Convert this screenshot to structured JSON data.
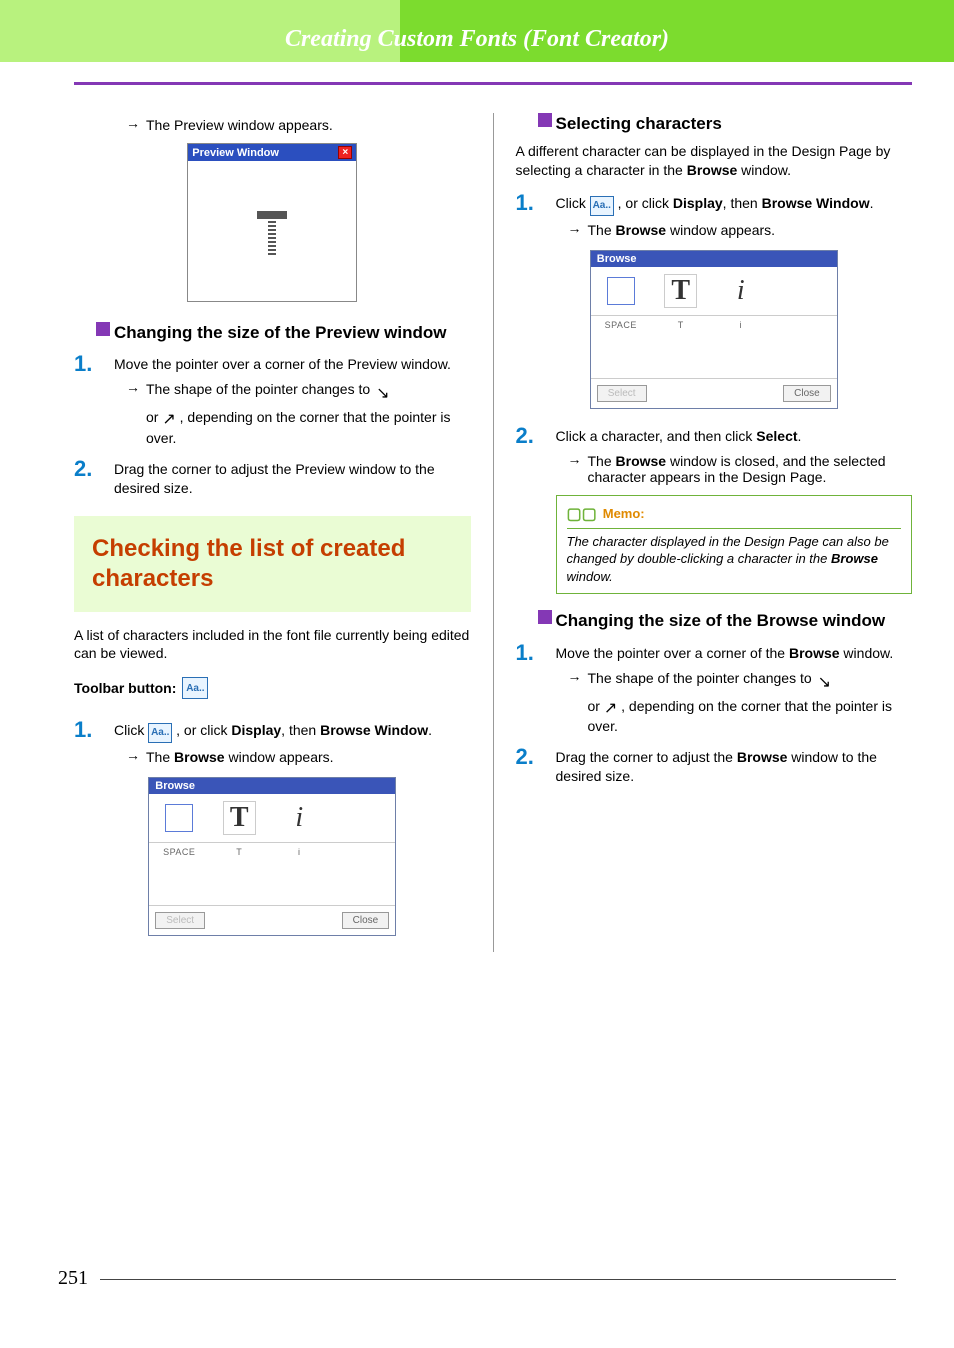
{
  "header": {
    "title": "Creating Custom Fonts (Font Creator)"
  },
  "left": {
    "preview_appears": "The Preview window appears.",
    "preview_window_title": "Preview Window",
    "sub_change_preview": "Changing the size of the Preview window",
    "step1": "Move the pointer over a corner of the Preview window.",
    "shape_changes": "The shape of the pointer changes to",
    "or_depending": "or         , depending on the corner that the pointer is over.",
    "step2": "Drag the corner to adjust the Preview window to the desired size.",
    "section_title": "Checking the list of created characters",
    "section_para": "A list of characters included in the font file currently being edited can be viewed.",
    "toolbar_label": "Toolbar button:",
    "click_prefix": "Click",
    "or_click": ", or click ",
    "display": "Display",
    "then": ", then ",
    "browse_window": "Browse Window",
    "period": ".",
    "browse_appears": "The ",
    "browse_bold": "Browse",
    "browse_appears2": " window appears."
  },
  "right": {
    "sub_selecting": "Selecting characters",
    "selecting_para_a": "A different character can be displayed in the Design Page by selecting a character in the ",
    "selecting_para_b": "Browse",
    "selecting_para_c": " window.",
    "step1_click": "Click",
    "step1_or": ", or click ",
    "step1_display": "Display",
    "step1_then": ", then ",
    "step1_browse_window": "Browse Window",
    "step1_period": ".",
    "browse_appears_a": "The ",
    "browse_appears_b": "Browse",
    "browse_appears_c": " window appears.",
    "step2_a": "Click a character, and then click ",
    "step2_b": "Select",
    "step2_c": ".",
    "step2_result_a": "The ",
    "step2_result_b": "Browse",
    "step2_result_c": " window is closed, and the selected character appears in the Design Page.",
    "memo_label": "Memo:",
    "memo_a": "The character displayed in the Design Page can also be changed by double-clicking a character in the ",
    "memo_b": "Browse",
    "memo_c": " window.",
    "sub_change_browse": "Changing the size of the Browse window",
    "b_step1_a": "Move the pointer over a corner of the ",
    "b_step1_b": "Browse",
    "b_step1_c": " window.",
    "b_shape": "The shape of the pointer changes to",
    "b_or": "or         , depending on the corner that the pointer is over.",
    "b_step2_a": "Drag the corner to adjust the ",
    "b_step2_b": "Browse",
    "b_step2_c": " window to the desired size."
  },
  "browse_mock": {
    "title": "Browse",
    "labels": [
      "SPACE",
      "T",
      "i"
    ],
    "select_btn": "Select",
    "close_btn": "Close"
  },
  "page_number": "251"
}
